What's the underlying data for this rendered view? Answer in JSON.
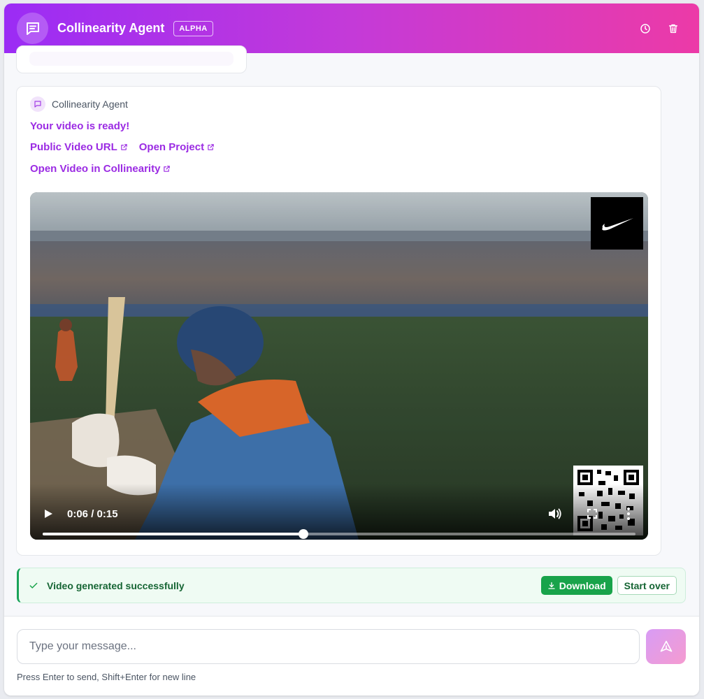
{
  "header": {
    "title": "Collinearity Agent",
    "badge": "ALPHA",
    "logo_icon": "chat-bubble-icon",
    "history_icon": "clock-icon",
    "delete_icon": "trash-icon"
  },
  "message": {
    "sender": "Collinearity Agent",
    "ready_text": "Your video is ready!",
    "links": {
      "public_url": "Public Video URL",
      "open_project": "Open Project",
      "open_in_app": "Open Video in Collinearity"
    }
  },
  "video": {
    "current_time": "0:06",
    "duration": "0:15",
    "time_display": "0:06 / 0:15",
    "progress": 0.44
  },
  "status": {
    "text": "Video generated successfully",
    "download_label": "Download",
    "start_over_label": "Start over"
  },
  "composer": {
    "placeholder": "Type your message...",
    "hint": "Press Enter to send, Shift+Enter for new line"
  },
  "colors": {
    "header_start": "#9b2cf5",
    "header_end": "#ec3aa7",
    "link": "#9b2be3",
    "success": "#18a34a"
  }
}
